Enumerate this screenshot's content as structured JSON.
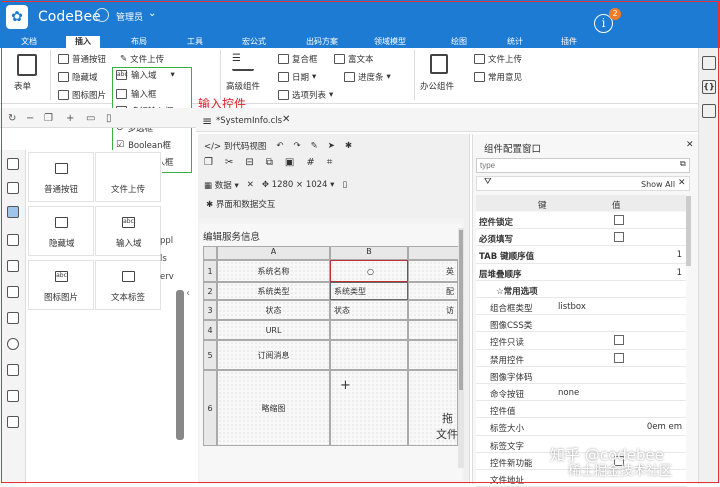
{
  "app": {
    "title": "CodeBee",
    "user": "管理员",
    "notifications": "2"
  },
  "tabs": [
    "文档",
    "插入",
    "布局",
    "工具",
    "宏公式",
    "出码方案",
    "领域模型",
    "绘图",
    "统计",
    "插件"
  ],
  "ribbon": {
    "form": "表单",
    "btn_normal": "普通按钮",
    "btn_upload": "文件上传",
    "btn_hidden": "隐藏域",
    "btn_input_field": "输入域",
    "btn_image": "图标图片",
    "advanced": "高级组件",
    "combo": "复合框",
    "richtext": "富文本",
    "date": "日期",
    "progress": "进度条",
    "options": "选项列表",
    "office": "办公组件",
    "upload2": "文件上传",
    "feedback": "常用意见"
  },
  "dropdown": [
    "输入框",
    "多行输入框",
    "多选框",
    "Boolean框",
    "密码输入框"
  ],
  "annotation": "输入控件",
  "file_tab": "*SystemInfo.cls",
  "palette": [
    {
      "label": "普通按钮"
    },
    {
      "label": "文件上传"
    },
    {
      "label": "隐藏域"
    },
    {
      "label": "输入域"
    },
    {
      "label": "图标图片"
    },
    {
      "label": "文本标签"
    }
  ],
  "palette_cut": "ppl ls erv",
  "designer": {
    "to_code": "到代码视图",
    "data": "数据",
    "size": "1280 × 1024",
    "interaction": "界面和数据交互",
    "form_title": "编辑服务信息",
    "col_a": "A",
    "col_b": "B",
    "rows": [
      {
        "n": "1",
        "label": "系统名称",
        "right": "英"
      },
      {
        "n": "2",
        "label": "系统类型",
        "value": "系统类型",
        "right": "配"
      },
      {
        "n": "3",
        "label": "状态",
        "value": "状态",
        "right": "访"
      },
      {
        "n": "4",
        "label": "URL"
      },
      {
        "n": "5",
        "label": "订阅消息"
      },
      {
        "n": "6",
        "label": "略缩图",
        "drop": "拖",
        "drop2": "文件"
      }
    ]
  },
  "config": {
    "title": "组件配置窗口",
    "type_placeholder": "type",
    "show_all": "Show All",
    "col_key": "键",
    "col_value": "值",
    "rows": [
      {
        "k": "控件锁定",
        "bold": true,
        "cb": true
      },
      {
        "k": "必须填写",
        "bold": true,
        "cb": true
      },
      {
        "k": "TAB 键顺序值",
        "bold": true,
        "r": "1"
      },
      {
        "k": "层堆叠顺序",
        "bold": true,
        "r": "1"
      },
      {
        "k": "☆常用选项",
        "bold": true,
        "section": true
      },
      {
        "k": "组合框类型",
        "v": "listbox"
      },
      {
        "k": "图像CSS类"
      },
      {
        "k": "控件只读",
        "cb": true
      },
      {
        "k": "禁用控件",
        "cb": true
      },
      {
        "k": "图像字体码"
      },
      {
        "k": "命令按钮",
        "v": "none"
      },
      {
        "k": "控件值"
      },
      {
        "k": "标签大小",
        "r": "0em em"
      },
      {
        "k": "标签文字"
      },
      {
        "k": "控件新功能",
        "cb": true
      },
      {
        "k": "文件地址"
      }
    ]
  },
  "watermark": "知乎 @codebee",
  "watermark2": "稀土掘金技术社区"
}
